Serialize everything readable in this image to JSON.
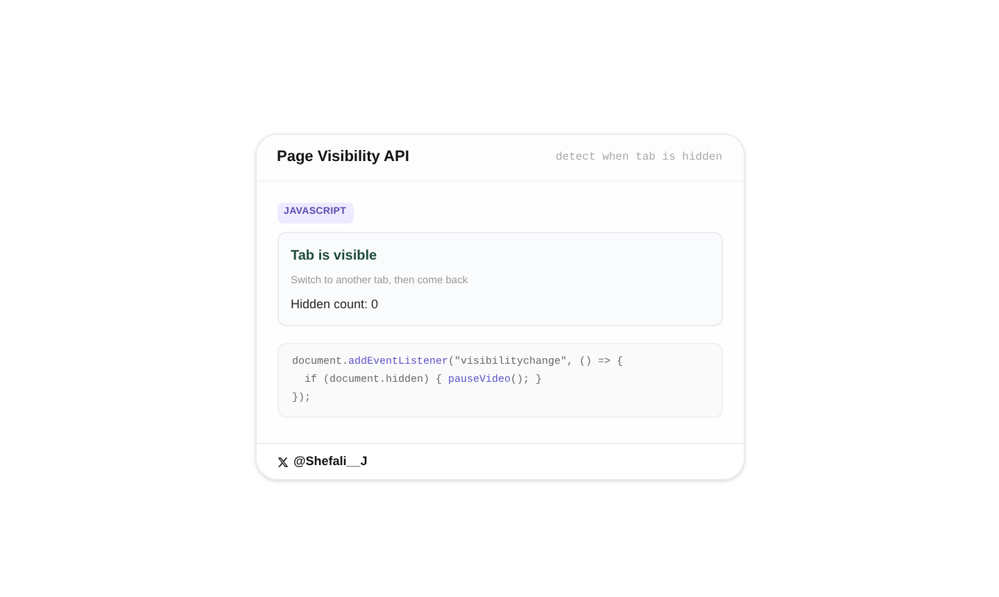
{
  "card": {
    "title": "Page Visibility API",
    "subtitle": "detect when tab is hidden"
  },
  "tag": "JAVASCRIPT",
  "status": {
    "title": "Tab is visible",
    "hint": "Switch to another tab, then come back",
    "count": "Hidden count: 0"
  },
  "code": [
    [
      {
        "kind": "plain",
        "text": "document."
      },
      {
        "kind": "fn",
        "text": "addEventListener"
      },
      {
        "kind": "plain",
        "text": "(\"visibilitychange\", () => {"
      }
    ],
    [
      {
        "kind": "plain",
        "text": "  if (document.hidden) { "
      },
      {
        "kind": "fn",
        "text": "pauseVideo"
      },
      {
        "kind": "plain",
        "text": "(); }"
      }
    ],
    [
      {
        "kind": "plain",
        "text": "});"
      }
    ]
  ],
  "footer": {
    "handle": "@Shefali__J"
  }
}
